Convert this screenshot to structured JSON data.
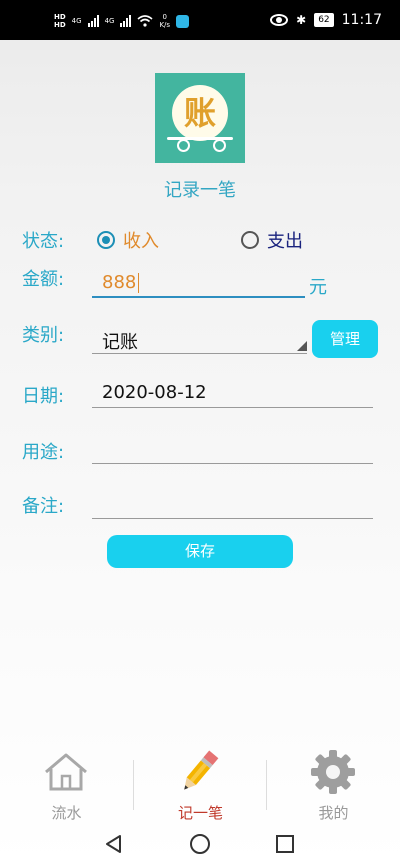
{
  "status_bar": {
    "hd_top": "HD",
    "hd_bottom": "HD",
    "net_1": "4G",
    "net_2": "4G",
    "speed_value": "0",
    "speed_unit": "K/s",
    "battery": "62",
    "time": "11:17"
  },
  "header": {
    "logo_char": "账",
    "subtitle": "记录一笔"
  },
  "form": {
    "status_label": "状态:",
    "income_label": "收入",
    "expense_label": "支出",
    "selected_status": "income",
    "amount_label": "金额:",
    "amount_value": "888",
    "amount_unit": "元",
    "category_label": "类别:",
    "category_value": "记账",
    "manage_button": "管理",
    "date_label": "日期:",
    "date_value": "2020-08-12",
    "purpose_label": "用途:",
    "purpose_value": "",
    "note_label": "备注:",
    "note_value": "",
    "save_button": "保存"
  },
  "bottom_nav": {
    "items": [
      {
        "label": "流水",
        "icon": "house-icon",
        "active": false
      },
      {
        "label": "记一笔",
        "icon": "pencil-icon",
        "active": true
      },
      {
        "label": "我的",
        "icon": "gear-icon",
        "active": false
      }
    ]
  },
  "system_nav": [
    "back-triangle-icon",
    "home-circle-icon",
    "recents-square-icon"
  ],
  "colors": {
    "accent": "#2aa8c8",
    "button": "#19d0ee",
    "logo_bg": "#43b59f",
    "active_nav": "#c0392b",
    "amount_text": "#e08a2c"
  }
}
